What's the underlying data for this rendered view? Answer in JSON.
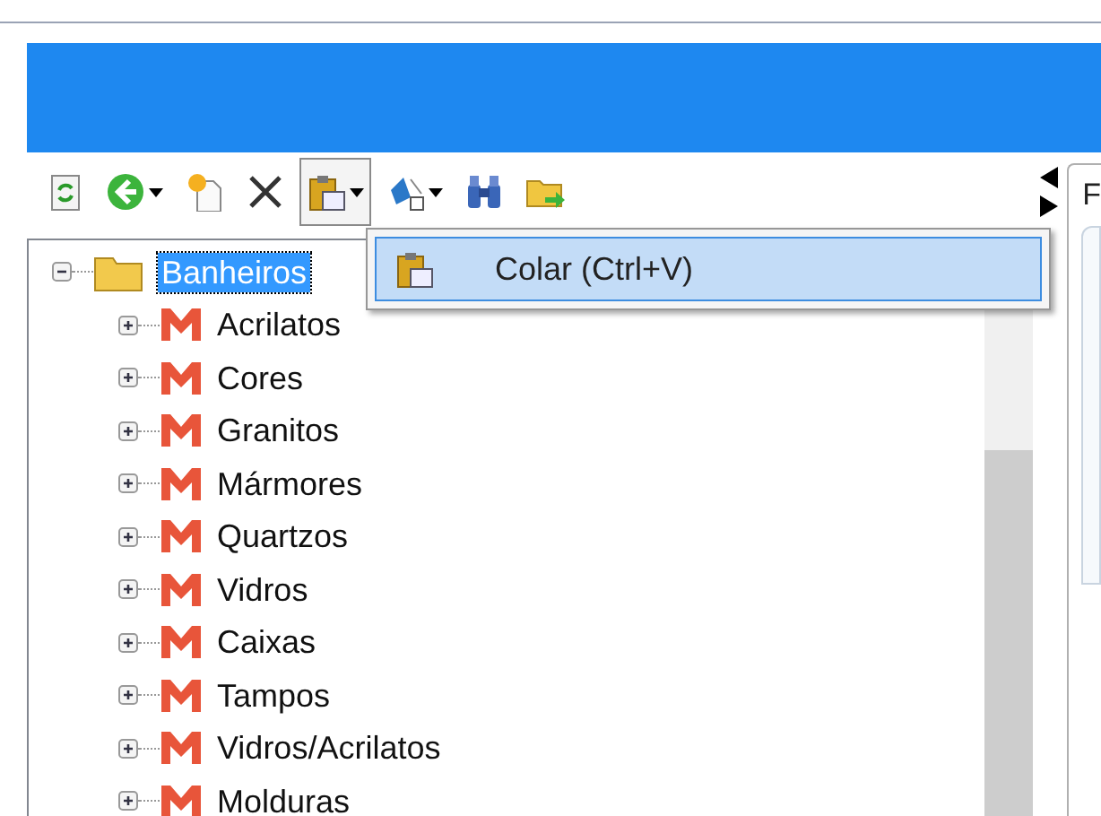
{
  "toolbar": [
    {
      "kind": "refresh",
      "dropdown": false,
      "pressed": false
    },
    {
      "kind": "back",
      "dropdown": true,
      "pressed": false
    },
    {
      "kind": "new",
      "dropdown": false,
      "pressed": false
    },
    {
      "kind": "delete",
      "dropdown": false,
      "pressed": false
    },
    {
      "kind": "paste",
      "dropdown": true,
      "pressed": true
    },
    {
      "kind": "sort",
      "dropdown": true,
      "pressed": false
    },
    {
      "kind": "find",
      "dropdown": false,
      "pressed": false
    },
    {
      "kind": "move",
      "dropdown": false,
      "pressed": false
    }
  ],
  "menu": {
    "items": [
      {
        "label": "Colar (Ctrl+V)",
        "selected": true
      }
    ]
  },
  "tree": {
    "items": [
      {
        "label": "Banheiros",
        "selected": true,
        "expanded": true,
        "children": [
          {
            "label": "Acrilatos",
            "selected": false,
            "expanded": false
          },
          {
            "label": "Cores",
            "selected": false,
            "expanded": false
          },
          {
            "label": "Granitos",
            "selected": false,
            "expanded": false
          },
          {
            "label": "Mármores",
            "selected": false,
            "expanded": false
          },
          {
            "label": "Quartzos",
            "selected": false,
            "expanded": false
          },
          {
            "label": "Vidros",
            "selected": false,
            "expanded": false
          },
          {
            "label": "Caixas",
            "selected": false,
            "expanded": false
          },
          {
            "label": "Tampos",
            "selected": false,
            "expanded": false
          },
          {
            "label": "Vidros/Acrilatos",
            "selected": false,
            "expanded": false
          },
          {
            "label": "Molduras",
            "selected": false,
            "expanded": false
          }
        ]
      }
    ]
  },
  "right_panel": {
    "tab_label": "F"
  }
}
